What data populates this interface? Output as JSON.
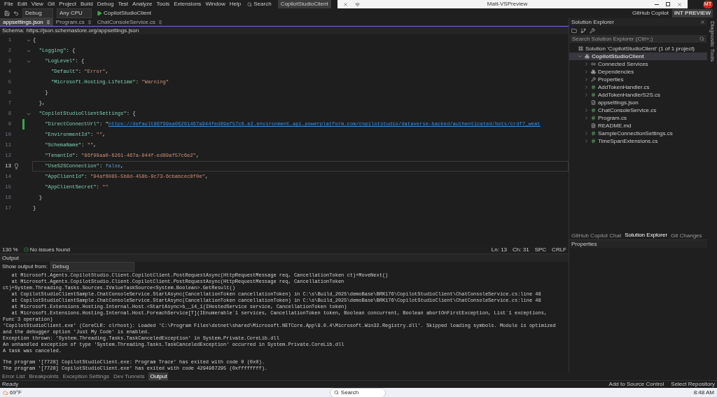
{
  "menu_bar": {
    "items": [
      "File",
      "Edit",
      "View",
      "Git",
      "Project",
      "Build",
      "Debug",
      "Test",
      "Analyze",
      "Tools",
      "Extensions",
      "Window",
      "Help"
    ],
    "search": "Search",
    "solution_badge": "CopilotStudioClient",
    "github_copilot": "GitHub Copilot",
    "avatar": "MT",
    "preview_badge": "INT PREVIEW"
  },
  "remote_bar": {
    "title": "Matt-VSPreview"
  },
  "toolbar": {
    "configuration": "Debug",
    "platform": "Any CPU",
    "start": "CopilotStudioClient"
  },
  "document_tabs": [
    {
      "label": "appsettings.json",
      "selected": true
    },
    {
      "label": "Program.cs",
      "selected": false
    },
    {
      "label": "ChatConsoleService.cs",
      "selected": false
    }
  ],
  "schema_bar": {
    "label": "Schema:",
    "value": "https://json.schemastore.org/appsettings.json"
  },
  "editor": {
    "lines": [
      {
        "number": "1",
        "foldable": true,
        "modified": false,
        "selected": false,
        "tokens": [
          {
            "kind": "punct",
            "text": "{"
          }
        ]
      },
      {
        "number": "2",
        "foldable": true,
        "modified": false,
        "selected": false,
        "tokens": [
          {
            "kind": "key",
            "text": "\"Logging\""
          },
          {
            "kind": "punct",
            "text": ": {"
          }
        ]
      },
      {
        "number": "3",
        "foldable": true,
        "modified": false,
        "selected": false,
        "tokens": [
          {
            "kind": "key",
            "text": "\"LogLevel\""
          },
          {
            "kind": "punct",
            "text": ": {"
          }
        ]
      },
      {
        "number": "4",
        "foldable": false,
        "modified": false,
        "selected": false,
        "tokens": [
          {
            "kind": "key",
            "text": "\"Default\""
          },
          {
            "kind": "punct",
            "text": ": "
          },
          {
            "kind": "string",
            "text": "\"Error\""
          },
          {
            "kind": "punct",
            "text": ","
          }
        ]
      },
      {
        "number": "5",
        "foldable": false,
        "modified": false,
        "selected": false,
        "tokens": [
          {
            "kind": "key",
            "text": "\"Microsoft.Hosting.Lifetime\""
          },
          {
            "kind": "punct",
            "text": ": "
          },
          {
            "kind": "string",
            "text": "\"Warning\""
          }
        ]
      },
      {
        "number": "6",
        "foldable": false,
        "modified": false,
        "selected": false,
        "tokens": [
          {
            "kind": "punct",
            "text": "}"
          }
        ]
      },
      {
        "number": "7",
        "foldable": false,
        "modified": false,
        "selected": false,
        "tokens": [
          {
            "kind": "punct",
            "text": "},"
          }
        ]
      },
      {
        "number": "8",
        "foldable": true,
        "modified": false,
        "selected": false,
        "tokens": [
          {
            "kind": "key",
            "text": "\"CopilotStudioClientSettings\""
          },
          {
            "kind": "punct",
            "text": ": {"
          }
        ]
      },
      {
        "number": "9",
        "foldable": false,
        "modified": true,
        "selected": false,
        "tokens": [
          {
            "kind": "key",
            "text": "\"DirectConnectUrl\""
          },
          {
            "kind": "punct",
            "text": ": \""
          },
          {
            "kind": "link",
            "text": "https://default86f99aa06261467a944fed89af57c6.e2.environment.api.powerplatform.com/copilotstudio/dataverse-backed/authenticated/bots/crdf7_weat"
          }
        ]
      },
      {
        "number": "10",
        "foldable": false,
        "modified": false,
        "selected": false,
        "tokens": [
          {
            "kind": "key",
            "text": "\"EnvironmentId\""
          },
          {
            "kind": "punct",
            "text": ": "
          },
          {
            "kind": "string",
            "text": "\"\""
          },
          {
            "kind": "punct",
            "text": ","
          }
        ]
      },
      {
        "number": "11",
        "foldable": false,
        "modified": false,
        "selected": false,
        "tokens": [
          {
            "kind": "key",
            "text": "\"SchemaName\""
          },
          {
            "kind": "punct",
            "text": ": "
          },
          {
            "kind": "string",
            "text": "\"\""
          },
          {
            "kind": "punct",
            "text": ","
          }
        ]
      },
      {
        "number": "12",
        "foldable": false,
        "modified": false,
        "selected": false,
        "tokens": [
          {
            "kind": "key",
            "text": "\"TenantId\""
          },
          {
            "kind": "punct",
            "text": ": "
          },
          {
            "kind": "string",
            "text": "\"86f99aa0-6261-467a-944f-ed89af57c6e2\""
          },
          {
            "kind": "punct",
            "text": ","
          }
        ]
      },
      {
        "number": "13",
        "foldable": false,
        "modified": false,
        "selected": true,
        "tokens": [
          {
            "kind": "key",
            "text": "\"UseS2SConnection\""
          },
          {
            "kind": "punct",
            "text": ": "
          },
          {
            "kind": "keyword",
            "text": "false"
          },
          {
            "kind": "punct",
            "text": ","
          }
        ]
      },
      {
        "number": "14",
        "foldable": false,
        "modified": false,
        "selected": false,
        "tokens": [
          {
            "kind": "key",
            "text": "\"AppClientId\""
          },
          {
            "kind": "punct",
            "text": ": "
          },
          {
            "kind": "string",
            "text": "\"94af6085-5b8d-458b-9c73-6cbabcec8f0e\""
          },
          {
            "kind": "punct",
            "text": ","
          }
        ]
      },
      {
        "number": "15",
        "foldable": false,
        "modified": false,
        "selected": false,
        "tokens": [
          {
            "kind": "key",
            "text": "\"AppClientSecret\""
          },
          {
            "kind": "punct",
            "text": ": "
          },
          {
            "kind": "string",
            "text": "\"\""
          }
        ]
      },
      {
        "number": "16",
        "foldable": false,
        "modified": false,
        "selected": false,
        "tokens": [
          {
            "kind": "punct",
            "text": "}"
          }
        ]
      },
      {
        "number": "17",
        "foldable": false,
        "modified": false,
        "selected": false,
        "tokens": [
          {
            "kind": "punct",
            "text": "}"
          }
        ]
      }
    ]
  },
  "editor_status": {
    "zoom": "130 %",
    "issues": "No issues found",
    "line": "Ln: 13",
    "column": "Ch: 31",
    "spacing": "SPC",
    "line_ending": "CRLF"
  },
  "output": {
    "title": "Output",
    "source_label": "Show output from:",
    "source": "Debug",
    "blocks": [
      [
        "   at Microsoft.Agents.CopilotStudio.Client.CopilotClient.PostRequestAsync(HttpRequestMessage req, CancellationToken ct)+MoveNext()",
        "   at Microsoft.Agents.CopilotStudio.Client.CopilotClient.PostRequestAsync(HttpRequestMessage req, CancellationToken ct)+System.Threading.Tasks.Sources.IValueTaskSource<System.Boolean>.GetResult()",
        "   at CopilotStudioClientSample.ChatConsoleService.StartAsync(CancellationToken cancellationToken) in C:\\s\\Build_2025\\demoBase\\BRK176\\CopilotStudioClient\\ChatConsoleService.cs:line 48",
        "   at CopilotStudioClientSample.ChatConsoleService.StartAsync(CancellationToken cancellationToken) in C:\\s\\Build_2025\\demoBase\\BRK176\\CopilotStudioClient\\ChatConsoleService.cs:line 48",
        "   at Microsoft.Extensions.Hosting.Internal.Host.<StartAsync>b__14_1(IHostedService service, CancellationToken token)",
        "   at Microsoft.Extensions.Hosting.Internal.Host.ForeachService[T](IEnumerable`1 services, CancellationToken token, Boolean concurrent, Boolean abortOnFirstException, List`1 exceptions, Func`3 operation)",
        "'CopilotStudioClient.exe' (CoreCLR: clrhost): Loaded 'C:\\Program Files\\dotnet\\shared\\Microsoft.NETCore.App\\9.0.4\\Microsoft.Win32.Registry.dll'. Skipped loading symbols. Module is optimized and the debugger option 'Just My Code' is enabled.",
        "Exception thrown: 'System.Threading.Tasks.TaskCanceledException' in System.Private.CoreLib.dll",
        "An unhandled exception of type 'System.Threading.Tasks.TaskCanceledException' occurred in System.Private.CoreLib.dll",
        "A task was canceled."
      ],
      [
        "The program '[7728] CopilotStudioClient.exe: Program Trace' has exited with code 0 (0x0).",
        "The program '[7728] CopilotStudioClient.exe' has exited with code 4294967295 (0xffffffff)."
      ]
    ]
  },
  "bottom_tabs": [
    {
      "label": "Error List",
      "selected": false
    },
    {
      "label": "Breakpoints",
      "selected": false
    },
    {
      "label": "Exception Settings",
      "selected": false
    },
    {
      "label": "Dev Tunnels",
      "selected": false
    },
    {
      "label": "Output",
      "selected": true
    }
  ],
  "solution_explorer": {
    "title": "Solution Explorer",
    "search": {
      "placeholder": "Search Solution Explorer (Ctrl+;)"
    },
    "tree": [
      {
        "label": "Solution 'CopilotStudioClient' (1 of 1 project)",
        "kind": "solution",
        "selected": false,
        "children": [
          {
            "label": "CopilotStudioClient",
            "kind": "project",
            "expandable": true,
            "expanded": true,
            "selected": true,
            "children": [
              {
                "label": "Connected Services",
                "kind": "services",
                "expandable": true,
                "expanded": false,
                "selected": false
              },
              {
                "label": "Dependencies",
                "kind": "dependencies",
                "expandable": true,
                "expanded": false,
                "selected": false
              },
              {
                "label": "Properties",
                "kind": "folder",
                "expandable": true,
                "expanded": false,
                "selected": false
              },
              {
                "label": "AddTokenHandler.cs",
                "kind": "csharp",
                "expandable": true,
                "expanded": false,
                "selected": false
              },
              {
                "label": "AddTokenHandlerS2S.cs",
                "kind": "csharp",
                "expandable": true,
                "expanded": false,
                "selected": false
              },
              {
                "label": "appsettings.json",
                "kind": "json",
                "expandable": false,
                "expanded": false,
                "selected": false
              },
              {
                "label": "ChatConsoleService.cs",
                "kind": "csharp",
                "expandable": true,
                "expanded": false,
                "selected": false
              },
              {
                "label": "Program.cs",
                "kind": "csharp",
                "expandable": true,
                "expanded": false,
                "selected": false
              },
              {
                "label": "README.md",
                "kind": "markdown",
                "expandable": false,
                "expanded": false,
                "selected": false
              },
              {
                "label": "SampleConnectionSettings.cs",
                "kind": "csharp",
                "expandable": true,
                "expanded": false,
                "selected": false
              },
              {
                "label": "TimeSpanExtensions.cs",
                "kind": "csharp",
                "expandable": true,
                "expanded": false,
                "selected": false
              }
            ]
          }
        ]
      }
    ],
    "tabs": [
      {
        "label": "GitHub Copilot Chat",
        "selected": false
      },
      {
        "label": "Solution Explorer",
        "selected": true
      },
      {
        "label": "Git Changes",
        "selected": false
      }
    ]
  },
  "side_strip": {
    "label": "Diagnostic Tools"
  },
  "properties": {
    "title": "Properties"
  },
  "status_bar": {
    "state": "Ready",
    "source_control": "Add to Source Control",
    "repository": "Select Repository"
  },
  "taskbar": {
    "weather": "69°F",
    "search": "Search",
    "time": "8:48 AM"
  }
}
